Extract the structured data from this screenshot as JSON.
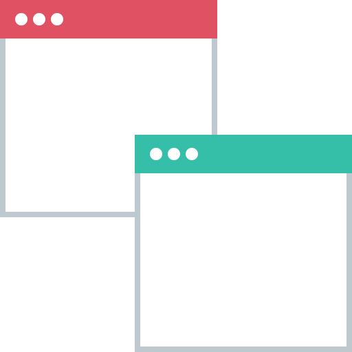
{
  "windows": [
    {
      "id": "back",
      "titlebar_color": "#e05263",
      "controls": [
        "dot-icon",
        "dot-icon",
        "dot-icon"
      ]
    },
    {
      "id": "front",
      "titlebar_color": "#35bea8",
      "controls": [
        "dot-icon",
        "dot-icon",
        "dot-icon"
      ]
    }
  ],
  "frame_color": "#bdc8cf"
}
